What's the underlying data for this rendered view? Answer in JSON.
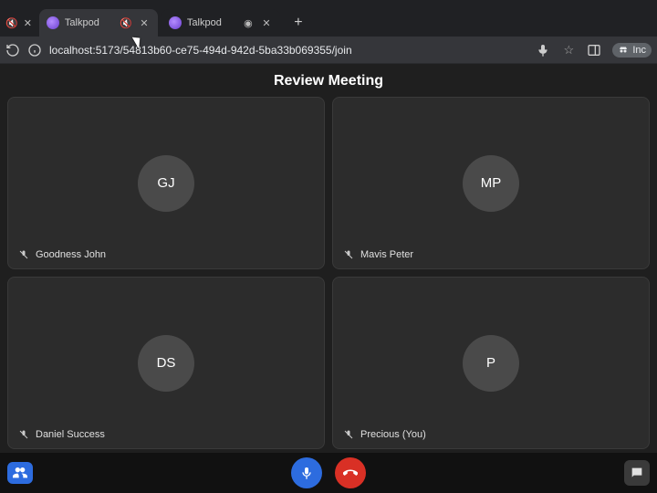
{
  "browser": {
    "prev_tab_close_visible": true,
    "tabs": [
      {
        "title": "Talkpod",
        "audio_indicator": "🔇",
        "active": true
      },
      {
        "title": "Talkpod",
        "audio_indicator": "◉",
        "active": false
      }
    ],
    "addr": {
      "url": "localhost:5173/54813b60-ce75-494d-942d-5ba33b069355/join",
      "trailing_label": "Inc"
    }
  },
  "meeting": {
    "title": "Review Meeting",
    "participants": [
      {
        "initials": "GJ",
        "name": "Goodness John",
        "mic_muted": true
      },
      {
        "initials": "MP",
        "name": "Mavis Peter",
        "mic_muted": true
      },
      {
        "initials": "DS",
        "name": "Daniel Success",
        "mic_muted": true
      },
      {
        "initials": "P",
        "name": "Precious (You)",
        "mic_muted": true
      }
    ]
  },
  "colors": {
    "accent_blue": "#2d6cdf",
    "hangup_red": "#d93025",
    "tile_bg": "#2c2c2c"
  }
}
